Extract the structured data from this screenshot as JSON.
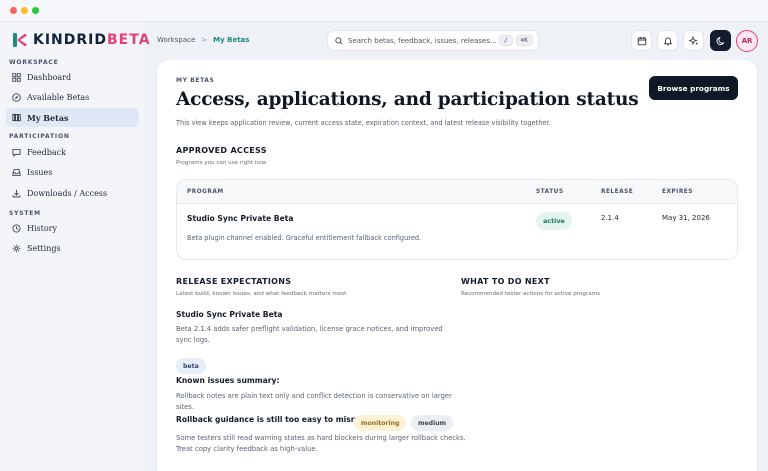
{
  "app": {
    "brand_primary": "KINDRID",
    "brand_accent": "BETA",
    "accent_color": "#e4417a",
    "teal_color": "#1b8a7d"
  },
  "sidebar": {
    "sections": [
      {
        "label": "WORKSPACE"
      },
      {
        "label": "PARTICIPATION"
      },
      {
        "label": "SYSTEM"
      }
    ],
    "items": [
      {
        "label": "Dashboard",
        "icon": "grid-icon"
      },
      {
        "label": "Available Betas",
        "icon": "compass-icon"
      },
      {
        "label": "My Betas",
        "icon": "library-icon",
        "active": true
      },
      {
        "label": "Feedback",
        "icon": "message-icon"
      },
      {
        "label": "Issues",
        "icon": "inbox-icon"
      },
      {
        "label": "Downloads / Access",
        "icon": "download-icon"
      },
      {
        "label": "History",
        "icon": "history-icon"
      },
      {
        "label": "Settings",
        "icon": "gear-icon"
      }
    ]
  },
  "topbar": {
    "breadcrumb": {
      "root": "Workspace",
      "separator": ">",
      "current": "My Betas"
    },
    "search": {
      "placeholder": "Search betas, feedback, issues, releases...",
      "shortcut_1": "/",
      "shortcut_2": "⌘K"
    },
    "avatar_initials": "AR"
  },
  "main": {
    "eyebrow": "MY BETAS",
    "title": "Access, applications, and participation status",
    "subtitle": "This view keeps application review, current access state, expiration context, and latest release visibility together.",
    "browse_button": "Browse programs",
    "approved": {
      "heading": "APPROVED ACCESS",
      "subheading": "Programs you can use right now",
      "columns": [
        "PROGRAM",
        "STATUS",
        "RELEASE",
        "EXPIRES"
      ],
      "rows": [
        {
          "program": "Studio Sync Private Beta",
          "description": "Beta plugin channel enabled. Graceful entitlement fallback configured.",
          "status": "active",
          "release": "2.1.4",
          "expires": "May 31, 2026"
        }
      ]
    },
    "release": {
      "heading": "RELEASE EXPECTATIONS",
      "subheading": "Latest build, known issues, and what feedback matters most",
      "program": "Studio Sync Private Beta",
      "summary": "Beta 2.1.4 adds safer preflight validation, license grace notices, and improved sync logs.",
      "channel_tag": "beta",
      "known_issues_label": "Known issues summary:",
      "known_issues": "Rollback notes are plain text only and conflict detection is conservative on larger sites.",
      "issue_title": "Rollback guidance is still too easy to misread",
      "issue_tag_1": "monitoring",
      "issue_tag_2": "medium",
      "issue_text": "Some testers still read warning states as hard blockers during larger rollback checks. Treat copy clarity feedback as high-value."
    },
    "next": {
      "heading": "WHAT TO DO NEXT",
      "subheading": "Recommended tester actions for active programs"
    }
  }
}
